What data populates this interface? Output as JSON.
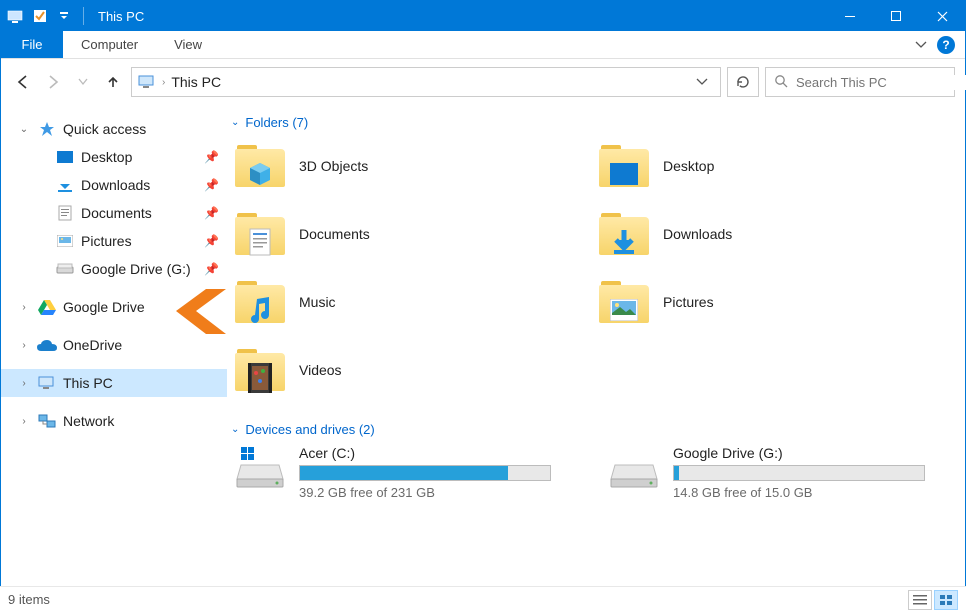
{
  "window": {
    "title": "This PC"
  },
  "ribbon": {
    "file": "File",
    "tabs": [
      "Computer",
      "View"
    ]
  },
  "nav": {
    "breadcrumb": "This PC",
    "search_placeholder": "Search This PC"
  },
  "tree": {
    "quick_access": {
      "label": "Quick access",
      "items": [
        {
          "label": "Desktop"
        },
        {
          "label": "Downloads"
        },
        {
          "label": "Documents"
        },
        {
          "label": "Pictures"
        },
        {
          "label": "Google Drive (G:)"
        }
      ]
    },
    "roots": [
      {
        "label": "Google Drive"
      },
      {
        "label": "OneDrive"
      },
      {
        "label": "This PC"
      },
      {
        "label": "Network"
      }
    ]
  },
  "groups": {
    "folders": {
      "header": "Folders (7)",
      "items": [
        {
          "label": "3D Objects",
          "badge": "cube"
        },
        {
          "label": "Desktop",
          "badge": "desktop"
        },
        {
          "label": "Documents",
          "badge": "doc"
        },
        {
          "label": "Downloads",
          "badge": "down"
        },
        {
          "label": "Music",
          "badge": "music"
        },
        {
          "label": "Pictures",
          "badge": "pic"
        },
        {
          "label": "Videos",
          "badge": "video"
        }
      ]
    },
    "drives": {
      "header": "Devices and drives (2)",
      "items": [
        {
          "name": "Acer (C:)",
          "info": "39.2 GB free of 231 GB",
          "fill_pct": 83,
          "type": "os"
        },
        {
          "name": "Google Drive (G:)",
          "info": "14.8 GB free of 15.0 GB",
          "fill_pct": 2,
          "type": "hdd"
        }
      ]
    }
  },
  "statusbar": {
    "text": "9 items"
  }
}
